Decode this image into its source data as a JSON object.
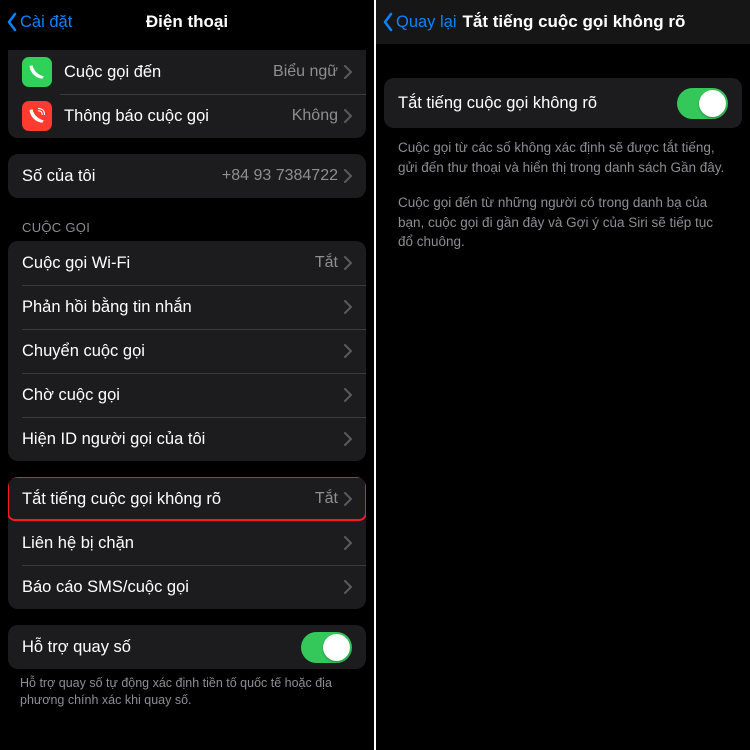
{
  "left": {
    "back": "Cài đặt",
    "title": "Điện thoại",
    "rows_icons": [
      {
        "icon": "green",
        "label": "Cuộc gọi đến",
        "detail": "Biểu ngữ"
      },
      {
        "icon": "red",
        "label": "Thông báo cuộc gọi",
        "detail": "Không"
      }
    ],
    "my_number_label": "Số của tôi",
    "my_number_value": "+84 93 7384722",
    "section_calls": "CUỘC GỌI",
    "calls": [
      {
        "label": "Cuộc gọi Wi-Fi",
        "detail": "Tắt"
      },
      {
        "label": "Phản hồi bằng tin nhắn",
        "detail": ""
      },
      {
        "label": "Chuyển cuộc gọi",
        "detail": ""
      },
      {
        "label": "Chờ cuộc gọi",
        "detail": ""
      },
      {
        "label": "Hiện ID người gọi của tôi",
        "detail": ""
      }
    ],
    "group3": [
      {
        "label": "Tắt tiếng cuộc gọi không rõ",
        "detail": "Tắt"
      },
      {
        "label": "Liên hệ bị chặn",
        "detail": ""
      },
      {
        "label": "Báo cáo SMS/cuộc gọi",
        "detail": ""
      }
    ],
    "dial_assist_label": "Hỗ trợ quay số",
    "dial_assist_footer": "Hỗ trợ quay số tự động xác định tiền tố quốc tế hoặc địa phương chính xác khi quay số."
  },
  "right": {
    "back": "Quay lại",
    "title": "Tắt tiếng cuộc gọi không rõ",
    "toggle_label": "Tắt tiếng cuộc gọi không rõ",
    "desc1": "Cuộc gọi từ các số không xác định sẽ được tắt tiếng, gửi đến thư thoại và hiển thị trong danh sách Gần đây.",
    "desc2": "Cuộc gọi đến từ những người có trong danh bạ của bạn, cuộc gọi đi gần đây và Gợi ý của Siri sẽ tiếp tục đổ chuông."
  }
}
